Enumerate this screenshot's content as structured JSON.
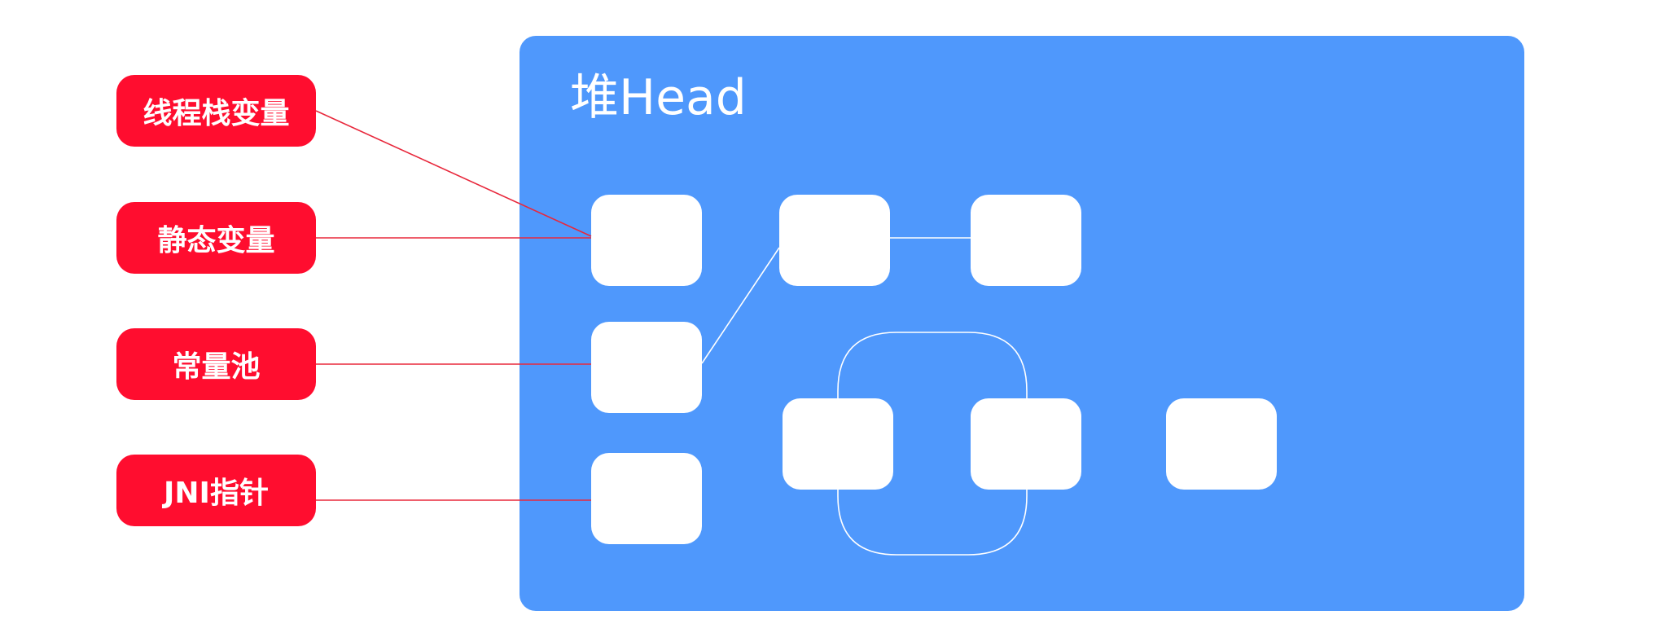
{
  "heap": {
    "title": "堆Head"
  },
  "roots": [
    {
      "id": "thread-stack-variable",
      "label": "线程栈变量"
    },
    {
      "id": "static-variable",
      "label": "静态变量"
    },
    {
      "id": "constant-pool",
      "label": "常量池"
    },
    {
      "id": "jni-pointer",
      "label": "JNI指针"
    }
  ],
  "colors": {
    "heap_background": "#4f98fc",
    "root_background": "#ff0d2f",
    "object_background": "#ffffff",
    "root_link": "#e8283c",
    "object_link": "#ffffff"
  }
}
